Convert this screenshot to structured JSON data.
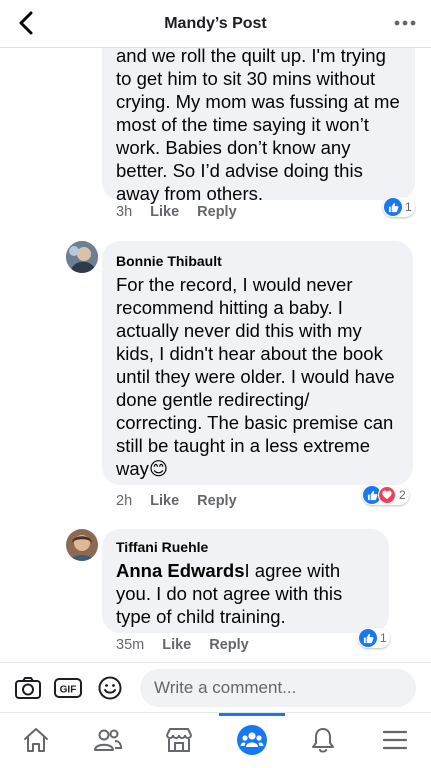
{
  "header": {
    "title": "Mandy’s Post",
    "back_icon": "chevron-left-icon",
    "more_icon": "more-horizontal-icon"
  },
  "comments": [
    {
      "partial_top": "and we roll the quilt up. I'm trying",
      "body": "to get him to sit 30 mins without crying.  My mom was fussing at me most of the time saying it won’t work.  Babies don’t know any better.  So I’d advise doing this away from others.",
      "time": "3h",
      "like_label": "Like",
      "reply_label": "Reply",
      "reaction_count": "1"
    },
    {
      "author": "Bonnie Thibault",
      "body": "For the record, I would never recommend hitting a baby. I actually never did this with my kids, I didn't hear about the book until they were older. I would have done gentle redirecting/ correcting. The basic premise can still be taught in a less extreme way",
      "emoji": "😊",
      "time": "2h",
      "like_label": "Like",
      "reply_label": "Reply",
      "reaction_count": "2"
    },
    {
      "author": "Tiffani Ruehle",
      "mention": "Anna Edwards",
      "body": "I agree with you. I do not agree with this type of child training.",
      "time": "35m",
      "like_label": "Like",
      "reply_label": "Reply",
      "reaction_count": "1"
    }
  ],
  "composer": {
    "placeholder": "Write a comment...",
    "icons": [
      "camera-icon",
      "gif-icon",
      "emoji-icon"
    ]
  },
  "tabbar": {
    "tabs": [
      "home-icon",
      "friends-icon",
      "marketplace-icon",
      "groups-icon",
      "notifications-icon",
      "menu-icon"
    ],
    "active_tab": "groups-icon"
  },
  "colors": {
    "accent": "#1877f2",
    "love": "#f33e58",
    "bubble": "#f0f2f5",
    "secondary_text": "#65676b"
  }
}
